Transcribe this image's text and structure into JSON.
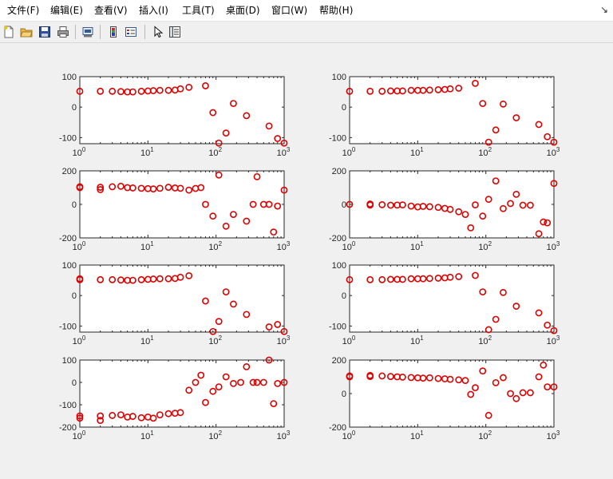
{
  "menu": {
    "items": [
      "文件(F)",
      "编辑(E)",
      "查看(V)",
      "插入(I)",
      "工具(T)",
      "桌面(D)",
      "窗口(W)",
      "帮助(H)"
    ],
    "corner_arrow": "↘"
  },
  "toolbar": {
    "buttons": [
      "new-file-icon",
      "open-folder-icon",
      "save-icon",
      "print-icon",
      "print-preview-icon",
      "colorbar-icon",
      "legend-icon",
      "pointer-icon",
      "property-editor-icon"
    ]
  },
  "style": {
    "marker_color": "#dd0000",
    "axes_bg": "#ffffff",
    "figure_bg": "#f0f0f0"
  },
  "chart_data": [
    {
      "type": "scatter",
      "xscale": "log",
      "xlim": [
        1,
        1000
      ],
      "ylim": [
        -120,
        100
      ],
      "yticks": [
        "100",
        "0",
        "-100"
      ],
      "x": [
        1,
        2,
        3,
        4,
        5,
        6,
        8,
        10,
        12,
        15,
        20,
        25,
        30,
        40,
        70,
        90,
        110,
        140,
        180,
        280,
        600,
        800,
        1000
      ],
      "y": [
        52,
        52,
        52,
        51,
        50,
        50,
        52,
        53,
        54,
        55,
        55,
        56,
        60,
        65,
        70,
        -18,
        -118,
        -85,
        12,
        -28,
        -62,
        -103,
        -118
      ]
    },
    {
      "type": "scatter",
      "xscale": "log",
      "xlim": [
        1,
        1000
      ],
      "ylim": [
        -120,
        100
      ],
      "yticks": [
        "100",
        "0",
        "-100"
      ],
      "x": [
        1,
        2,
        3,
        4,
        5,
        6,
        8,
        10,
        12,
        15,
        20,
        25,
        30,
        40,
        70,
        90,
        110,
        140,
        180,
        280,
        600,
        800,
        1000
      ],
      "y": [
        52,
        52,
        52,
        53,
        53,
        53,
        55,
        55,
        55,
        56,
        57,
        58,
        60,
        62,
        78,
        12,
        -115,
        -75,
        10,
        -35,
        -57,
        -97,
        -115
      ]
    },
    {
      "type": "scatter",
      "xscale": "log",
      "xlim": [
        1,
        1000
      ],
      "ylim": [
        -200,
        200
      ],
      "yticks": [
        "200",
        "0",
        "-200"
      ],
      "x": [
        1,
        1,
        2,
        2,
        3,
        4,
        5,
        6,
        8,
        10,
        12,
        15,
        20,
        25,
        30,
        40,
        50,
        60,
        70,
        90,
        110,
        140,
        180,
        280,
        350,
        400,
        500,
        600,
        700,
        800,
        1000
      ],
      "y": [
        100,
        105,
        88,
        102,
        105,
        108,
        100,
        98,
        96,
        94,
        92,
        96,
        102,
        98,
        96,
        85,
        95,
        100,
        0,
        -70,
        175,
        -130,
        -60,
        -100,
        0,
        165,
        0,
        0,
        -165,
        -10,
        85
      ]
    },
    {
      "type": "scatter",
      "xscale": "log",
      "xlim": [
        1,
        1000
      ],
      "ylim": [
        -200,
        200
      ],
      "yticks": [
        "200",
        "0",
        "-200"
      ],
      "x": [
        1,
        2,
        2,
        3,
        4,
        5,
        6,
        8,
        10,
        12,
        15,
        20,
        25,
        30,
        40,
        50,
        60,
        70,
        90,
        110,
        140,
        180,
        230,
        280,
        350,
        450,
        600,
        700,
        800,
        1000
      ],
      "y": [
        0,
        2,
        -4,
        -2,
        -5,
        -4,
        -3,
        -10,
        -15,
        -12,
        -14,
        -18,
        -24,
        -30,
        -44,
        -60,
        -140,
        -3,
        -70,
        30,
        140,
        -25,
        5,
        60,
        -5,
        -5,
        -175,
        -105,
        -110,
        125
      ]
    },
    {
      "type": "scatter",
      "xscale": "log",
      "xlim": [
        1,
        1000
      ],
      "ylim": [
        -120,
        100
      ],
      "yticks": [
        "100",
        "0",
        "-100"
      ],
      "x": [
        1,
        1,
        2,
        3,
        4,
        5,
        6,
        8,
        10,
        12,
        15,
        20,
        25,
        30,
        40,
        70,
        90,
        110,
        140,
        180,
        280,
        600,
        800,
        1000
      ],
      "y": [
        52,
        55,
        52,
        52,
        51,
        50,
        50,
        52,
        53,
        54,
        55,
        55,
        56,
        60,
        65,
        -18,
        -118,
        -85,
        12,
        -28,
        -62,
        -103,
        -95,
        -118
      ]
    },
    {
      "type": "scatter",
      "xscale": "log",
      "xlim": [
        1,
        1000
      ],
      "ylim": [
        -120,
        100
      ],
      "yticks": [
        "100",
        "0",
        "-100"
      ],
      "x": [
        1,
        2,
        3,
        4,
        5,
        6,
        8,
        10,
        12,
        15,
        20,
        25,
        30,
        40,
        70,
        90,
        110,
        140,
        180,
        280,
        600,
        800,
        1000
      ],
      "y": [
        52,
        52,
        52,
        53,
        53,
        53,
        55,
        55,
        55,
        56,
        57,
        58,
        60,
        62,
        66,
        12,
        -112,
        -78,
        10,
        -35,
        -57,
        -97,
        -115
      ]
    },
    {
      "type": "scatter",
      "xscale": "log",
      "xlim": [
        1,
        1000
      ],
      "ylim": [
        -200,
        100
      ],
      "yticks": [
        "100",
        "0",
        "-100",
        "-200"
      ],
      "x": [
        1,
        1,
        2,
        2,
        3,
        4,
        5,
        6,
        8,
        10,
        12,
        15,
        20,
        25,
        30,
        40,
        50,
        60,
        70,
        90,
        110,
        140,
        180,
        230,
        280,
        350,
        400,
        500,
        600,
        700,
        800,
        1000
      ],
      "y": [
        -150,
        -160,
        -170,
        -150,
        -148,
        -145,
        -155,
        -152,
        -158,
        -155,
        -160,
        -145,
        -140,
        -138,
        -135,
        -35,
        0,
        32,
        -90,
        -40,
        -20,
        25,
        -5,
        0,
        70,
        0,
        0,
        0,
        100,
        -95,
        -5,
        0
      ]
    },
    {
      "type": "scatter",
      "xscale": "log",
      "xlim": [
        1,
        1000
      ],
      "ylim": [
        -200,
        200
      ],
      "yticks": [
        "200",
        "0",
        "-200"
      ],
      "x": [
        1,
        1,
        2,
        2,
        3,
        4,
        5,
        6,
        8,
        10,
        12,
        15,
        20,
        25,
        30,
        40,
        50,
        60,
        70,
        90,
        110,
        140,
        180,
        230,
        280,
        350,
        450,
        600,
        700,
        800,
        1000
      ],
      "y": [
        100,
        105,
        102,
        108,
        105,
        102,
        100,
        98,
        96,
        94,
        92,
        94,
        90,
        88,
        85,
        82,
        78,
        -5,
        35,
        135,
        -130,
        65,
        95,
        0,
        -30,
        5,
        5,
        100,
        170,
        40,
        40
      ]
    }
  ]
}
